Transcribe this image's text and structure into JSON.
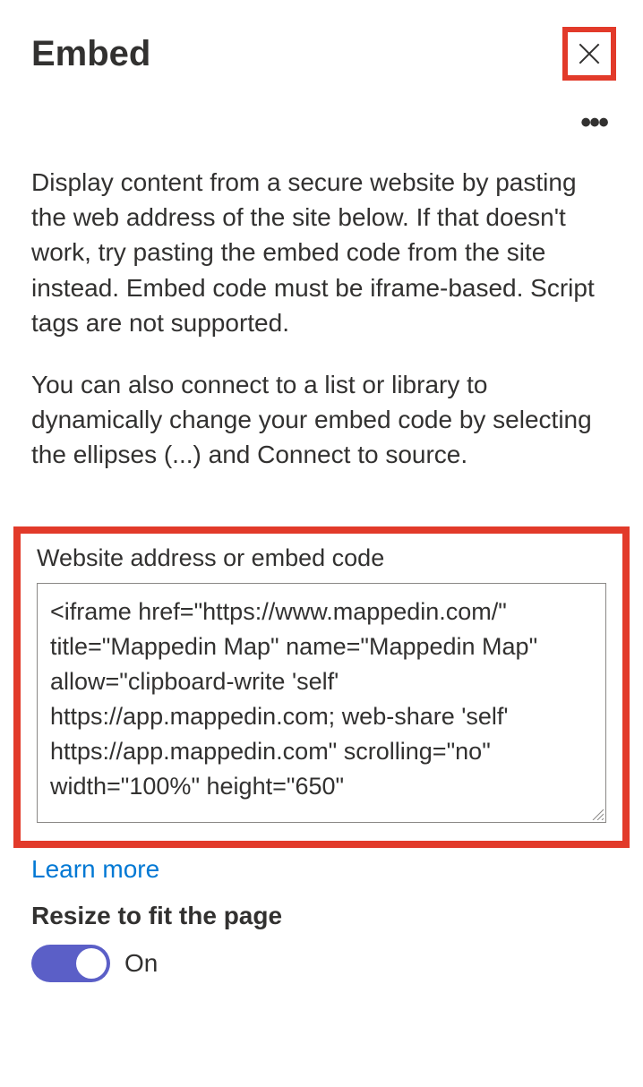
{
  "header": {
    "title": "Embed"
  },
  "description1": "Display content from a secure website by pasting the web address of the site below. If that doesn't work, try pasting the embed code from the site instead. Embed code must be iframe-based. Script tags are not supported.",
  "description2": "You can also connect to a list or library to dynamically change your embed code by selecting the ellipses (...) and Connect to source.",
  "embed": {
    "label": "Website address or embed code",
    "value": "<iframe href=\"https://www.mappedin.com/\" title=\"Mappedin Map\" name=\"Mappedin Map\" allow=\"clipboard-write 'self' https://app.mappedin.com; web-share 'self' https://app.mappedin.com\" scrolling=\"no\" width=\"100%\" height=\"650\""
  },
  "learnMore": "Learn more",
  "resize": {
    "label": "Resize to fit the page",
    "state": "On"
  },
  "ellipsis": "•••"
}
